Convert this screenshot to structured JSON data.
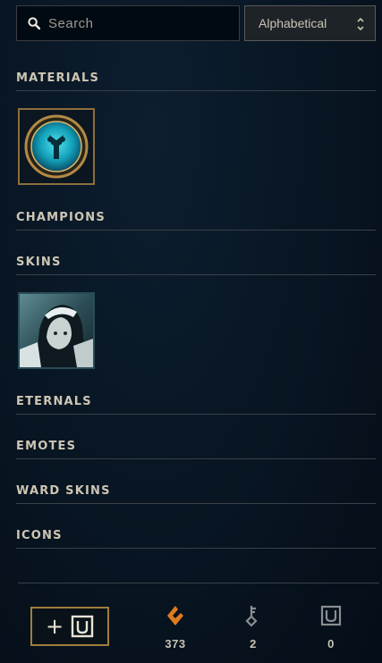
{
  "search": {
    "placeholder": "Search"
  },
  "sort": {
    "selected": "Alphabetical"
  },
  "sections": [
    {
      "title": "MATERIALS"
    },
    {
      "title": "CHAMPIONS"
    },
    {
      "title": "SKINS"
    },
    {
      "title": "ETERNALS"
    },
    {
      "title": "EMOTES"
    },
    {
      "title": "WARD SKINS"
    },
    {
      "title": "ICONS"
    }
  ],
  "materials_item": {
    "icon": "key-fragment-icon"
  },
  "skins_item": {
    "icon": "skin-shard-portrait"
  },
  "footer": {
    "add_icon": "add-chest-icon",
    "currencies": [
      {
        "icon": "orange-essence-icon",
        "value": "373",
        "color": "#e07b1f"
      },
      {
        "icon": "key-icon",
        "value": "2",
        "color": "#8a8e90"
      },
      {
        "icon": "chest-icon",
        "value": "0",
        "color": "#8a8e90"
      }
    ]
  },
  "colors": {
    "gold_border": "#8c6f3a",
    "text": "#cdc6b3",
    "background": "#081522"
  }
}
